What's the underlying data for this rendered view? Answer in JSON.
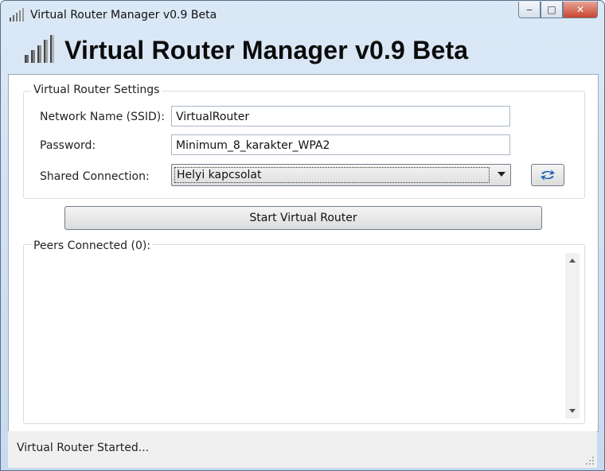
{
  "window": {
    "title": "Virtual Router Manager v0.9 Beta",
    "controls": {
      "minimize": "‒",
      "maximize": "□",
      "close": "✕"
    }
  },
  "banner": {
    "title": "Virtual Router Manager v0.9 Beta",
    "icon": "signal-bars-icon"
  },
  "settings": {
    "group_title": "Virtual Router Settings",
    "ssid_label": "Network Name (SSID):",
    "ssid_value": "VirtualRouter",
    "password_label": "Password:",
    "password_value": "Minimum_8_karakter_WPA2",
    "shared_label": "Shared Connection:",
    "shared_value": "Helyi kapcsolat"
  },
  "actions": {
    "start_label": "Start Virtual Router",
    "refresh_icon": "refresh-icon"
  },
  "peers": {
    "label": "Peers Connected (0):"
  },
  "status": {
    "text": "Virtual Router Started..."
  },
  "colors": {
    "accent": "#1e63b8",
    "title_bg": "#dbe8f6",
    "close_button": "#c9452f"
  }
}
